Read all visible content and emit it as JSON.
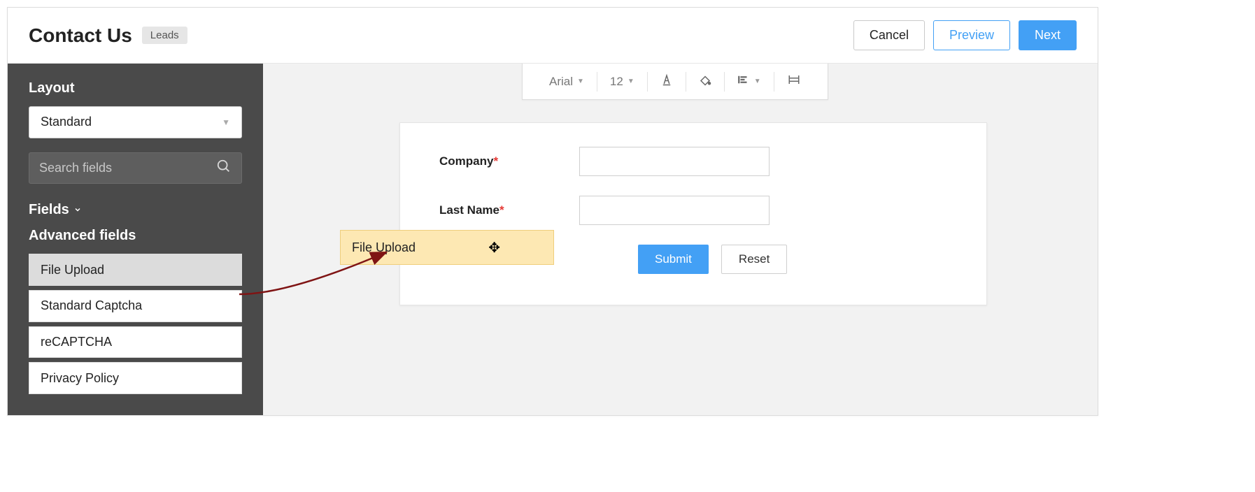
{
  "header": {
    "title": "Contact Us",
    "badge": "Leads",
    "cancel": "Cancel",
    "preview": "Preview",
    "next": "Next"
  },
  "sidebar": {
    "layout_label": "Layout",
    "layout_value": "Standard",
    "search_placeholder": "Search fields",
    "fields_label": "Fields",
    "advanced_label": "Advanced fields",
    "advanced_items": [
      "File Upload",
      "Standard Captcha",
      "reCAPTCHA",
      "Privacy Policy"
    ]
  },
  "toolbar": {
    "font": "Arial",
    "size": "12"
  },
  "form": {
    "fields": [
      {
        "label": "Company",
        "required": true
      },
      {
        "label": "Last Name",
        "required": true
      }
    ],
    "submit": "Submit",
    "reset": "Reset"
  },
  "drag_ghost": {
    "label": "File Upload"
  }
}
